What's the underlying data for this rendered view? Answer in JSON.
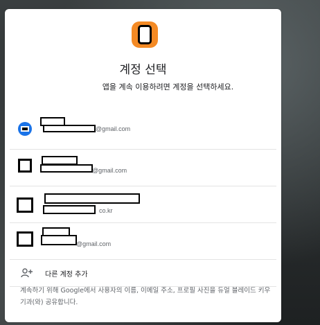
{
  "dialog": {
    "title": "계정 선택",
    "subtitle": "앱을 계속 이용하려면 계정을 선택하세요.",
    "accounts": [
      {
        "email_suffix": "@gmail.com"
      },
      {
        "email_suffix": "@gmail.com"
      },
      {
        "email_suffix": "co.kr"
      },
      {
        "email_suffix": "@gmail.com"
      }
    ],
    "add_account_label": "다른 계정 추가",
    "notice": "계속하기 위해 Google에서 사용자의 이름, 이메일 주소, 프로필 사진을 듀얼 블레이드 키우기과(와) 공유합니다."
  },
  "colors": {
    "app_icon": "#f48a24",
    "avatar_selected": "#1a73e8",
    "redaction": "#000000"
  },
  "icons": {
    "app_logo": "app-logo-icon",
    "add_account": "person-add-icon"
  }
}
